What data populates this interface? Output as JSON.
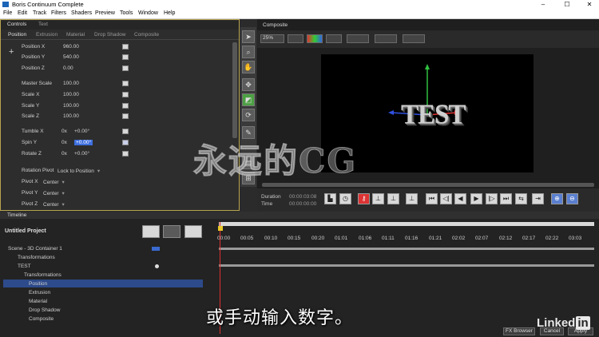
{
  "window": {
    "title": "Boris Continuum Complete",
    "minimize": "–",
    "maximize": "☐",
    "close": "✕"
  },
  "menu": [
    "File",
    "Edit",
    "Track",
    "Filters",
    "Shaders",
    "Preview",
    "Tools",
    "Window",
    "Help"
  ],
  "controls": {
    "tabs": [
      "Controls",
      "Text"
    ],
    "subtabs": [
      "Position",
      "Extrusion",
      "Material",
      "Drop Shadow",
      "Composite"
    ],
    "params": [
      {
        "label": "Position X",
        "value": "960.00"
      },
      {
        "label": "Position Y",
        "value": "540.00"
      },
      {
        "label": "Position Z",
        "value": "0.00"
      },
      {
        "label": "Master Scale",
        "value": "100.00"
      },
      {
        "label": "Scale X",
        "value": "100.00"
      },
      {
        "label": "Scale Y",
        "value": "100.00"
      },
      {
        "label": "Scale Z",
        "value": "100.00"
      }
    ],
    "rotations": [
      {
        "label": "Tumble X",
        "turns": "0x",
        "degrees": "+0.00°"
      },
      {
        "label": "Spin Y",
        "turns": "0x",
        "degrees": "+0.00°"
      },
      {
        "label": "Rotate Z",
        "turns": "0x",
        "degrees": "+0.00°"
      }
    ],
    "rotation_pivot": {
      "label": "Rotation Pivot",
      "value": "Lock to Position"
    },
    "pivots": [
      {
        "label": "Pivot X",
        "value": "Center"
      },
      {
        "label": "Pivot Y",
        "value": "Center"
      },
      {
        "label": "Pivot Z",
        "value": "Center"
      }
    ]
  },
  "composite": {
    "tab": "Composite",
    "zoom": "25%",
    "viewport_text": "TEST",
    "duration_label": "Duration",
    "duration_value": "00:00:03:08",
    "time_label": "Time",
    "time_value": "00:00:00:00"
  },
  "timeline": {
    "tab": "Timeline",
    "project": "Untitled Project",
    "tree": [
      "Scene - 3D Container 1",
      "Transformations",
      "TEST",
      "Transformations",
      "Position",
      "Extrusion",
      "Material",
      "Drop Shadow",
      "Composite"
    ],
    "ticks": [
      "00:00",
      "00:05",
      "00:10",
      "00:15",
      "00:20",
      "01:01",
      "01:06",
      "01:11",
      "01:16",
      "01:21",
      "02:02",
      "02:07",
      "02:12",
      "02:17",
      "02:22",
      "03:03"
    ],
    "buttons": {
      "fx_browser": "FX Browser",
      "cancel": "Cancel",
      "apply": "Apply"
    }
  },
  "overlay": {
    "subtitle": "或手动输入数字。",
    "watermark": "永远的CG",
    "brand": "Linked",
    "brand_in": "in"
  },
  "colors": {
    "panel_border": "#b7a44f",
    "selection": "#2d4a8a",
    "playhead": "#e03030",
    "axis_x": "#e03030",
    "axis_y": "#30c040",
    "axis_z": "#3050e0"
  }
}
